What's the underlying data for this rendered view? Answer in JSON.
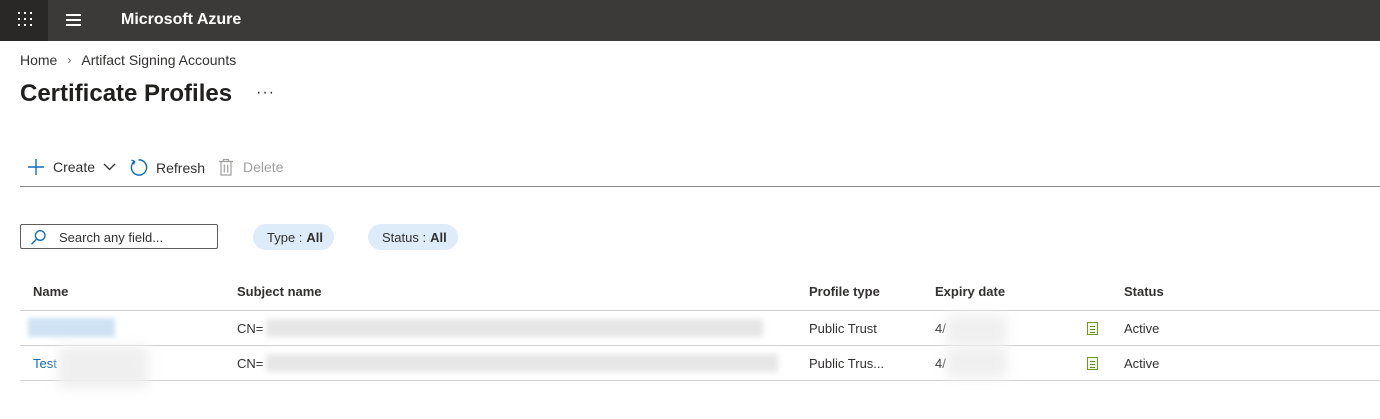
{
  "header": {
    "brand": "Microsoft Azure"
  },
  "breadcrumb": {
    "items": [
      "Home",
      "Artifact Signing Accounts"
    ],
    "separator": "›"
  },
  "page": {
    "title": "Certificate Profiles",
    "more": "···"
  },
  "toolbar": {
    "create_label": "Create",
    "refresh_label": "Refresh",
    "delete_label": "Delete"
  },
  "filters": {
    "search_placeholder": "Search any field...",
    "type_label": "Type :",
    "type_value": "All",
    "status_label": "Status :",
    "status_value": "All"
  },
  "table": {
    "columns": [
      "Name",
      "Subject name",
      "Profile type",
      "Expiry date",
      "Status"
    ],
    "rows": [
      {
        "name": "",
        "subject": "CN=",
        "profile_type": "Public Trust",
        "expiry": "4/",
        "status": "Active"
      },
      {
        "name": "Test",
        "subject": "CN=",
        "profile_type": "Public Trus...",
        "expiry": "4/",
        "status": "Active"
      }
    ]
  },
  "colors": {
    "topbar": "#3b3a39",
    "waffle_bg": "#292827",
    "accent": "#0f6cbd",
    "pill_bg": "#deecf9"
  },
  "icons": [
    "waffle-icon",
    "hamburger-icon",
    "plus-icon",
    "chevron-down-icon",
    "refresh-icon",
    "trash-icon",
    "search-icon",
    "certificate-icon"
  ]
}
